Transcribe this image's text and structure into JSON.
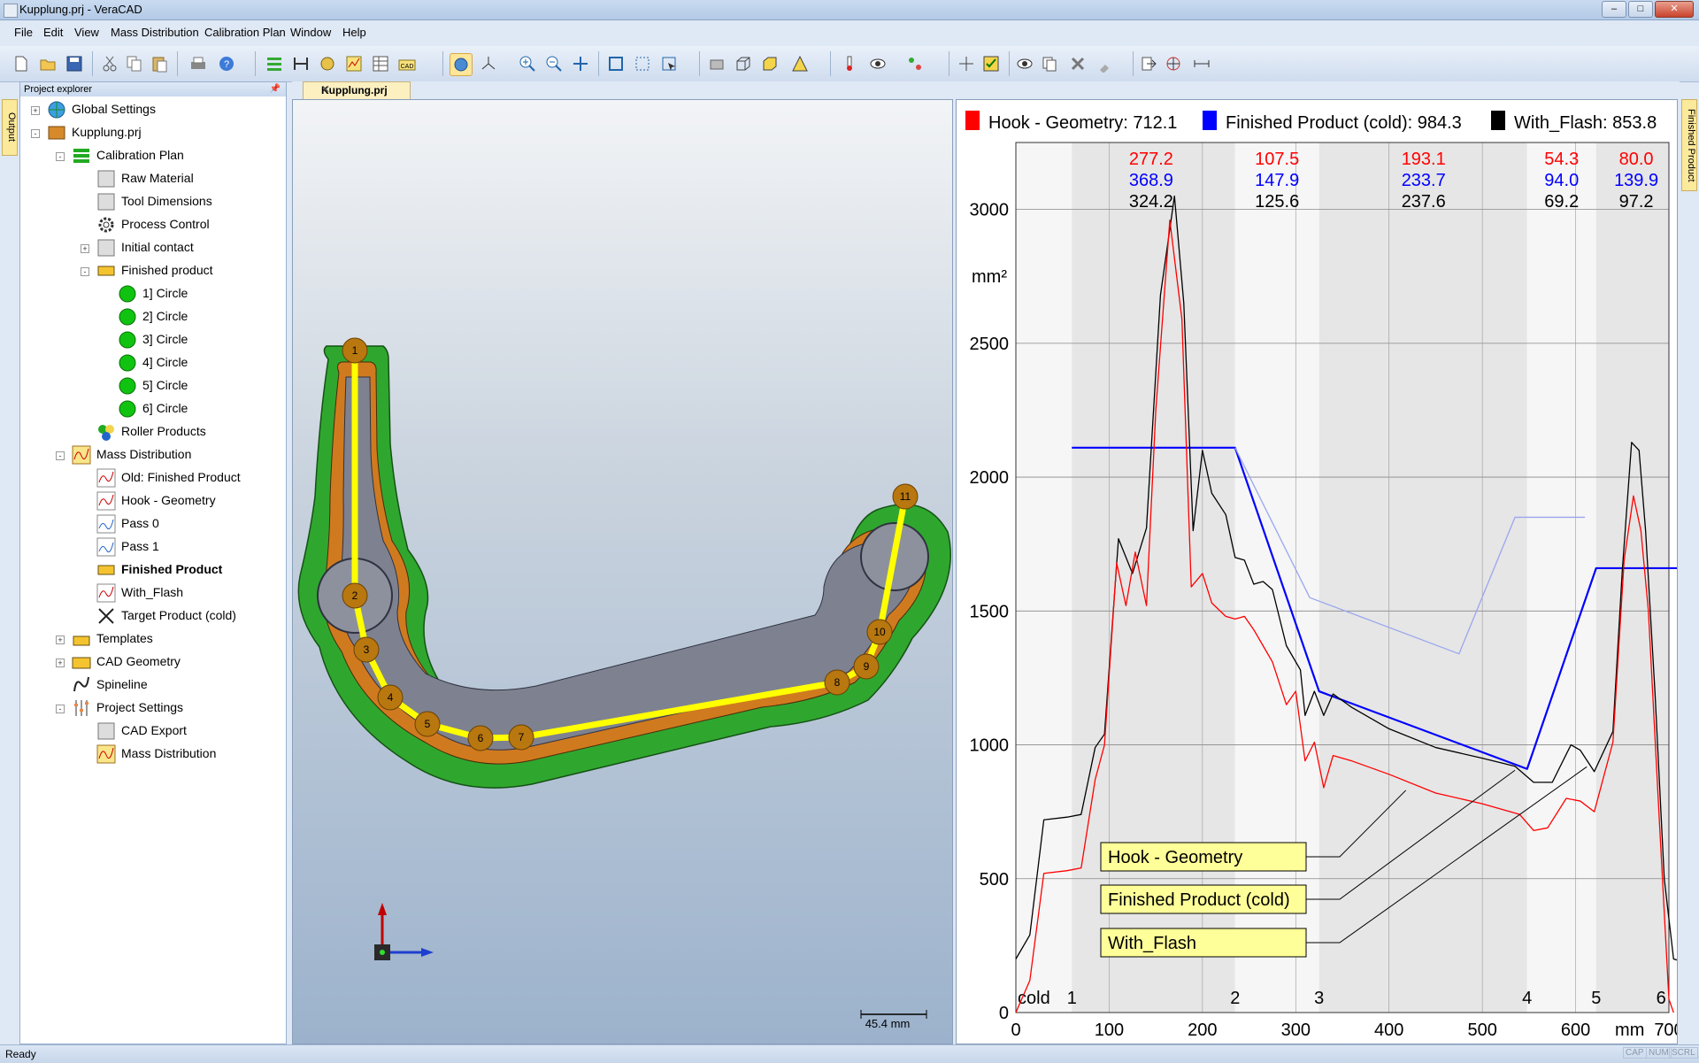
{
  "window": {
    "title": "Kupplung.prj - VeraCAD"
  },
  "menu": [
    "File",
    "Edit",
    "View",
    "Mass Distribution",
    "Calibration Plan",
    "Window",
    "Help"
  ],
  "explorer": {
    "title": "Project explorer",
    "items": [
      {
        "label": "Global Settings",
        "level": 0,
        "exp": "+",
        "icon": "globe-icon"
      },
      {
        "label": "Kupplung.prj",
        "level": 0,
        "exp": "-",
        "icon": "project-icon"
      },
      {
        "label": "Calibration Plan",
        "level": 1,
        "exp": "-",
        "icon": "calibration-plan-icon"
      },
      {
        "label": "Raw Material",
        "level": 2,
        "icon": "raw-material-icon"
      },
      {
        "label": "Tool Dimensions",
        "level": 2,
        "icon": "tool-dimensions-icon"
      },
      {
        "label": "Process Control",
        "level": 2,
        "icon": "gear-icon"
      },
      {
        "label": "Initial contact",
        "level": 2,
        "exp": "+",
        "icon": "initial-contact-icon"
      },
      {
        "label": "Finished product",
        "level": 2,
        "exp": "-",
        "icon": "finished-product-icon"
      },
      {
        "label": "1] Circle",
        "level": 3,
        "icon": "circle-icon"
      },
      {
        "label": "2] Circle",
        "level": 3,
        "icon": "circle-icon"
      },
      {
        "label": "3] Circle",
        "level": 3,
        "icon": "circle-icon"
      },
      {
        "label": "4] Circle",
        "level": 3,
        "icon": "circle-icon"
      },
      {
        "label": "5] Circle",
        "level": 3,
        "icon": "circle-icon"
      },
      {
        "label": "6] Circle",
        "level": 3,
        "icon": "circle-icon"
      },
      {
        "label": "Roller Products",
        "level": 2,
        "icon": "roller-products-icon"
      },
      {
        "label": "Mass Distribution",
        "level": 1,
        "exp": "-",
        "icon": "mass-distribution-icon"
      },
      {
        "label": "Old: Finished Product",
        "level": 2,
        "icon": "curve-icon"
      },
      {
        "label": "Hook - Geometry",
        "level": 2,
        "icon": "curve-icon"
      },
      {
        "label": "Pass 0",
        "level": 2,
        "icon": "pass-icon"
      },
      {
        "label": "Pass 1",
        "level": 2,
        "icon": "pass-icon"
      },
      {
        "label": "Finished Product",
        "level": 2,
        "icon": "finished-product-icon",
        "bold": true
      },
      {
        "label": "With_Flash",
        "level": 2,
        "icon": "curve-icon"
      },
      {
        "label": "Target Product (cold)",
        "level": 2,
        "icon": "target-icon"
      },
      {
        "label": "Templates",
        "level": 1,
        "exp": "+",
        "icon": "templates-icon"
      },
      {
        "label": "CAD Geometry",
        "level": 1,
        "exp": "+",
        "icon": "cad-icon"
      },
      {
        "label": "Spineline",
        "level": 1,
        "icon": "spineline-icon"
      },
      {
        "label": "Project Settings",
        "level": 1,
        "exp": "-",
        "icon": "settings-icon"
      },
      {
        "label": "CAD Export",
        "level": 2,
        "icon": "cad-export-icon"
      },
      {
        "label": "Mass Distribution",
        "level": 2,
        "icon": "mass-distribution-icon"
      }
    ]
  },
  "side_tabs": {
    "left": "Output",
    "right": "Finished Product"
  },
  "document_tab": "Kupplung.prj",
  "viewport": {
    "scale_label": "45.4 mm",
    "stations": [
      {
        "n": "1",
        "x": 400,
        "y": 395
      },
      {
        "n": "2",
        "x": 400,
        "y": 672
      },
      {
        "n": "3",
        "x": 413,
        "y": 733
      },
      {
        "n": "4",
        "x": 440,
        "y": 787
      },
      {
        "n": "5",
        "x": 482,
        "y": 817
      },
      {
        "n": "6",
        "x": 542,
        "y": 833
      },
      {
        "n": "7",
        "x": 588,
        "y": 832
      },
      {
        "n": "8",
        "x": 945,
        "y": 770
      },
      {
        "n": "9",
        "x": 978,
        "y": 752
      },
      {
        "n": "10",
        "x": 993,
        "y": 713
      },
      {
        "n": "11",
        "x": 1022,
        "y": 560
      }
    ]
  },
  "chart_data": {
    "type": "line",
    "legend": [
      {
        "name": "Hook - Geometry: 712.1",
        "color": "#ff0000"
      },
      {
        "name": "Finished Product (cold): 984.3",
        "color": "#0000ff"
      },
      {
        "name": "With_Flash: 853.8",
        "color": "#000000"
      }
    ],
    "ylabel": "mm²",
    "xlabel": "mm",
    "xlim": [
      0,
      700
    ],
    "ylim": [
      0,
      3250
    ],
    "xticks": [
      0,
      100,
      200,
      300,
      400,
      500,
      600,
      700
    ],
    "yticks": [
      0,
      500,
      1000,
      1500,
      2000,
      2500,
      3000
    ],
    "sections": [
      {
        "label": "cold",
        "x": 0
      },
      {
        "label": "1",
        "x": 60
      },
      {
        "label": "2",
        "x": 235
      },
      {
        "label": "3",
        "x": 325
      },
      {
        "label": "4",
        "x": 548
      },
      {
        "label": "5",
        "x": 622
      },
      {
        "label": "6",
        "x": 703
      }
    ],
    "band_values": [
      {
        "x": 145,
        "red": "277.2",
        "blue": "368.9",
        "black": "324.2"
      },
      {
        "x": 280,
        "red": "107.5",
        "blue": "147.9",
        "black": "125.6"
      },
      {
        "x": 437,
        "red": "193.1",
        "blue": "233.7",
        "black": "237.6"
      },
      {
        "x": 585,
        "red": "54.3",
        "blue": "94.0",
        "black": "69.2"
      },
      {
        "x": 665,
        "red": "80.0",
        "blue": "139.9",
        "black": "97.2"
      }
    ],
    "series": [
      {
        "name": "Finished Product (cold)",
        "color": "#0000ff",
        "points": [
          [
            60,
            2110
          ],
          [
            235,
            2110
          ],
          [
            325,
            1200
          ],
          [
            548,
            910
          ],
          [
            622,
            1660
          ],
          [
            710,
            1660
          ]
        ]
      },
      {
        "name": "Old: Finished Product",
        "color": "#9aa6ee",
        "points": [
          [
            235,
            2110
          ],
          [
            315,
            1550
          ],
          [
            475,
            1340
          ],
          [
            535,
            1850
          ],
          [
            610,
            1850
          ]
        ]
      },
      {
        "name": "With_Flash",
        "color": "#000000",
        "points": [
          [
            0,
            200
          ],
          [
            15,
            290
          ],
          [
            30,
            720
          ],
          [
            55,
            730
          ],
          [
            70,
            740
          ],
          [
            85,
            990
          ],
          [
            95,
            1040
          ],
          [
            110,
            1770
          ],
          [
            125,
            1640
          ],
          [
            140,
            1810
          ],
          [
            155,
            2680
          ],
          [
            170,
            3050
          ],
          [
            180,
            2650
          ],
          [
            190,
            1800
          ],
          [
            200,
            2100
          ],
          [
            210,
            1940
          ],
          [
            225,
            1860
          ],
          [
            235,
            1700
          ],
          [
            245,
            1690
          ],
          [
            255,
            1600
          ],
          [
            265,
            1610
          ],
          [
            275,
            1580
          ],
          [
            290,
            1370
          ],
          [
            305,
            1280
          ],
          [
            310,
            1110
          ],
          [
            320,
            1200
          ],
          [
            330,
            1110
          ],
          [
            340,
            1190
          ],
          [
            360,
            1140
          ],
          [
            400,
            1060
          ],
          [
            450,
            990
          ],
          [
            500,
            950
          ],
          [
            535,
            920
          ],
          [
            555,
            860
          ],
          [
            575,
            860
          ],
          [
            595,
            1000
          ],
          [
            605,
            980
          ],
          [
            620,
            900
          ],
          [
            640,
            1050
          ],
          [
            650,
            1650
          ],
          [
            660,
            2130
          ],
          [
            668,
            2100
          ],
          [
            675,
            1800
          ],
          [
            685,
            1200
          ],
          [
            695,
            500
          ],
          [
            705,
            200
          ],
          [
            710,
            195
          ]
        ]
      },
      {
        "name": "Hook - Geometry",
        "color": "#ff0000",
        "points": [
          [
            0,
            0
          ],
          [
            15,
            120
          ],
          [
            30,
            520
          ],
          [
            55,
            530
          ],
          [
            70,
            540
          ],
          [
            85,
            870
          ],
          [
            95,
            1000
          ],
          [
            108,
            1680
          ],
          [
            118,
            1520
          ],
          [
            128,
            1720
          ],
          [
            140,
            1520
          ],
          [
            150,
            2250
          ],
          [
            165,
            2960
          ],
          [
            178,
            2590
          ],
          [
            188,
            1590
          ],
          [
            200,
            1640
          ],
          [
            210,
            1530
          ],
          [
            225,
            1480
          ],
          [
            235,
            1470
          ],
          [
            245,
            1480
          ],
          [
            255,
            1430
          ],
          [
            265,
            1370
          ],
          [
            275,
            1310
          ],
          [
            290,
            1150
          ],
          [
            300,
            1200
          ],
          [
            310,
            940
          ],
          [
            320,
            1010
          ],
          [
            330,
            840
          ],
          [
            340,
            960
          ],
          [
            360,
            940
          ],
          [
            400,
            890
          ],
          [
            450,
            820
          ],
          [
            500,
            780
          ],
          [
            540,
            740
          ],
          [
            555,
            680
          ],
          [
            570,
            690
          ],
          [
            590,
            800
          ],
          [
            605,
            790
          ],
          [
            620,
            750
          ],
          [
            640,
            1010
          ],
          [
            652,
            1690
          ],
          [
            662,
            1930
          ],
          [
            670,
            1800
          ],
          [
            678,
            1500
          ],
          [
            690,
            700
          ],
          [
            700,
            50
          ],
          [
            705,
            0
          ]
        ]
      }
    ],
    "callouts": [
      "Hook - Geometry",
      "Finished Product (cold)",
      "With_Flash"
    ]
  },
  "status": {
    "text": "Ready",
    "indicators": [
      "CAP",
      "NUM",
      "SCRL"
    ]
  }
}
